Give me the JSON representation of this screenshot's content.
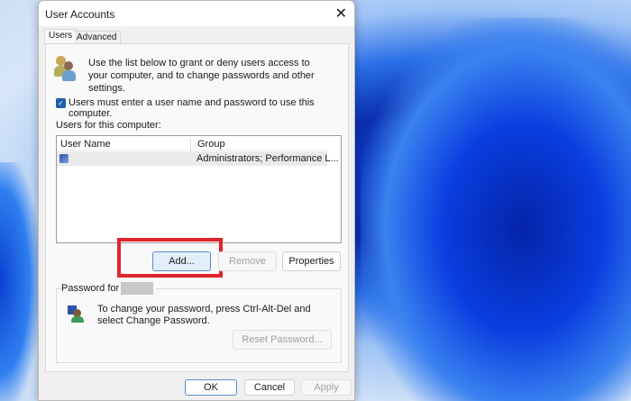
{
  "dialog": {
    "title": "User Accounts",
    "close_icon": "close-icon"
  },
  "tabs": [
    {
      "label": "Users",
      "active": true
    },
    {
      "label": "Advanced",
      "active": false
    }
  ],
  "intro_text": "Use the list below to grant or deny users access to your computer, and to change passwords and other settings.",
  "require_login_checkbox": {
    "label": "Users must enter a user name and password to use this computer.",
    "checked": true
  },
  "users_label": "Users for this computer:",
  "users_table": {
    "columns": [
      "User Name",
      "Group"
    ],
    "rows": [
      {
        "user_name": "",
        "group": "Administrators; Performance L..."
      }
    ]
  },
  "buttons": {
    "add": "Add...",
    "remove": "Remove",
    "properties": "Properties",
    "reset_password": "Reset Password...",
    "ok": "OK",
    "cancel": "Cancel",
    "apply": "Apply"
  },
  "password_group": {
    "label": "Password for",
    "text": "To change your password, press Ctrl-Alt-Del and select Change Password."
  },
  "highlight_color": "#e0242c"
}
